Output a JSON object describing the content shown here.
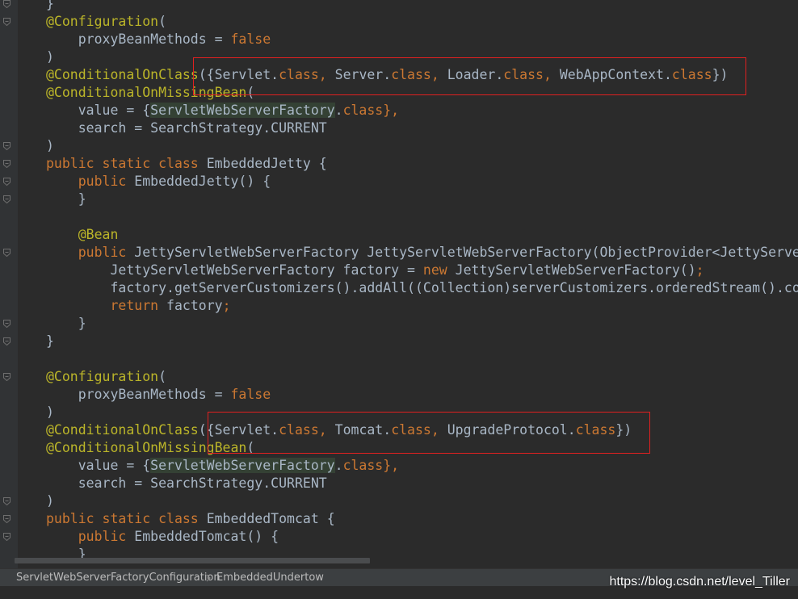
{
  "colors": {
    "background": "#2b2b2b",
    "keyword": "#cc7832",
    "annotation": "#bbb529",
    "text": "#a9b7c6",
    "highlight_box": "#e02020",
    "usage_highlight": "#344134"
  },
  "code_lines": [
    {
      "fold": true,
      "tokens": [
        {
          "t": "}",
          "c": "plain"
        }
      ]
    },
    {
      "fold": true,
      "tokens": [
        {
          "t": "@Configuration",
          "c": "ann"
        },
        {
          "t": "(",
          "c": "plain"
        }
      ]
    },
    {
      "fold": false,
      "tokens": [
        {
          "t": "    proxyBeanMethods = ",
          "c": "plain"
        },
        {
          "t": "false",
          "c": "kw"
        }
      ]
    },
    {
      "fold": false,
      "tokens": [
        {
          "t": ")",
          "c": "plain"
        }
      ]
    },
    {
      "fold": false,
      "tokens": [
        {
          "t": "@ConditionalOnClass",
          "c": "ann"
        },
        {
          "t": "({Servlet.",
          "c": "plain"
        },
        {
          "t": "class",
          "c": "kw"
        },
        {
          "t": ", ",
          "c": "kw"
        },
        {
          "t": "Server.",
          "c": "plain"
        },
        {
          "t": "class",
          "c": "kw"
        },
        {
          "t": ", ",
          "c": "kw"
        },
        {
          "t": "Loader.",
          "c": "plain"
        },
        {
          "t": "class",
          "c": "kw"
        },
        {
          "t": ", ",
          "c": "kw"
        },
        {
          "t": "WebAppContext.",
          "c": "plain"
        },
        {
          "t": "class",
          "c": "kw"
        },
        {
          "t": "})",
          "c": "plain"
        }
      ]
    },
    {
      "fold": false,
      "tokens": [
        {
          "t": "@ConditionalOnMissingBean",
          "c": "ann"
        },
        {
          "t": "(",
          "c": "plain"
        }
      ]
    },
    {
      "fold": false,
      "tokens": [
        {
          "t": "    value = {",
          "c": "plain"
        },
        {
          "t": "ServletWebServerFactory",
          "c": "hl"
        },
        {
          "t": ".",
          "c": "plain"
        },
        {
          "t": "class",
          "c": "kw"
        },
        {
          "t": "},",
          "c": "kw"
        }
      ]
    },
    {
      "fold": false,
      "tokens": [
        {
          "t": "    search = SearchStrategy.CURRENT",
          "c": "plain"
        }
      ]
    },
    {
      "fold": true,
      "tokens": [
        {
          "t": ")",
          "c": "plain"
        }
      ]
    },
    {
      "fold": true,
      "tokens": [
        {
          "t": "public static class ",
          "c": "kw"
        },
        {
          "t": "EmbeddedJetty {",
          "c": "plain"
        }
      ]
    },
    {
      "fold": true,
      "tokens": [
        {
          "t": "    ",
          "c": "plain"
        },
        {
          "t": "public ",
          "c": "kw"
        },
        {
          "t": "EmbeddedJetty() {",
          "c": "plain"
        }
      ]
    },
    {
      "fold": true,
      "tokens": [
        {
          "t": "    }",
          "c": "plain"
        }
      ]
    },
    {
      "fold": false,
      "tokens": [
        {
          "t": "",
          "c": "plain"
        }
      ]
    },
    {
      "fold": false,
      "tokens": [
        {
          "t": "    ",
          "c": "plain"
        },
        {
          "t": "@Bean",
          "c": "ann"
        }
      ]
    },
    {
      "fold": true,
      "tokens": [
        {
          "t": "    ",
          "c": "plain"
        },
        {
          "t": "public ",
          "c": "kw"
        },
        {
          "t": "JettyServletWebServerFactory JettyServletWebServerFactory(ObjectProvider<JettyServerCustomizer>",
          "c": "plain"
        }
      ]
    },
    {
      "fold": false,
      "tokens": [
        {
          "t": "        JettyServletWebServerFactory factory = ",
          "c": "plain"
        },
        {
          "t": "new ",
          "c": "kw"
        },
        {
          "t": "JettyServletWebServerFactory()",
          "c": "plain"
        },
        {
          "t": ";",
          "c": "kw"
        }
      ]
    },
    {
      "fold": false,
      "tokens": [
        {
          "t": "        factory.getServerCustomizers().addAll((Collection)serverCustomizers.orderedStream().collect(",
          "c": "plain"
        }
      ]
    },
    {
      "fold": false,
      "tokens": [
        {
          "t": "        ",
          "c": "plain"
        },
        {
          "t": "return ",
          "c": "kw"
        },
        {
          "t": "factory",
          "c": "plain"
        },
        {
          "t": ";",
          "c": "kw"
        }
      ]
    },
    {
      "fold": true,
      "tokens": [
        {
          "t": "    }",
          "c": "plain"
        }
      ]
    },
    {
      "fold": true,
      "tokens": [
        {
          "t": "}",
          "c": "plain"
        }
      ]
    },
    {
      "fold": false,
      "tokens": [
        {
          "t": "",
          "c": "plain"
        }
      ]
    },
    {
      "fold": true,
      "tokens": [
        {
          "t": "@Configuration",
          "c": "ann"
        },
        {
          "t": "(",
          "c": "plain"
        }
      ]
    },
    {
      "fold": false,
      "tokens": [
        {
          "t": "    proxyBeanMethods = ",
          "c": "plain"
        },
        {
          "t": "false",
          "c": "kw"
        }
      ]
    },
    {
      "fold": false,
      "tokens": [
        {
          "t": ")",
          "c": "plain"
        }
      ]
    },
    {
      "fold": false,
      "tokens": [
        {
          "t": "@ConditionalOnClass",
          "c": "ann"
        },
        {
          "t": "({Servlet.",
          "c": "plain"
        },
        {
          "t": "class",
          "c": "kw"
        },
        {
          "t": ", ",
          "c": "kw"
        },
        {
          "t": "Tomcat.",
          "c": "plain"
        },
        {
          "t": "class",
          "c": "kw"
        },
        {
          "t": ", ",
          "c": "kw"
        },
        {
          "t": "UpgradeProtocol.",
          "c": "plain"
        },
        {
          "t": "class",
          "c": "kw"
        },
        {
          "t": "})",
          "c": "plain"
        }
      ]
    },
    {
      "fold": false,
      "tokens": [
        {
          "t": "@ConditionalOnMissingBean",
          "c": "ann"
        },
        {
          "t": "(",
          "c": "plain"
        }
      ]
    },
    {
      "fold": false,
      "tokens": [
        {
          "t": "    value = {",
          "c": "plain"
        },
        {
          "t": "ServletWebServerFactory",
          "c": "hl"
        },
        {
          "t": ".",
          "c": "plain"
        },
        {
          "t": "class",
          "c": "kw"
        },
        {
          "t": "},",
          "c": "kw"
        }
      ]
    },
    {
      "fold": false,
      "tokens": [
        {
          "t": "    search = SearchStrategy.CURRENT",
          "c": "plain"
        }
      ]
    },
    {
      "fold": true,
      "tokens": [
        {
          "t": ")",
          "c": "plain"
        }
      ]
    },
    {
      "fold": true,
      "tokens": [
        {
          "t": "public static class ",
          "c": "kw"
        },
        {
          "t": "EmbeddedTomcat {",
          "c": "plain"
        }
      ]
    },
    {
      "fold": true,
      "tokens": [
        {
          "t": "    ",
          "c": "plain"
        },
        {
          "t": "public ",
          "c": "kw"
        },
        {
          "t": "EmbeddedTomcat() {",
          "c": "plain"
        }
      ]
    },
    {
      "fold": false,
      "tokens": [
        {
          "t": "    }",
          "c": "plain"
        }
      ]
    }
  ],
  "breadcrumb": {
    "items": [
      "ServletWebServerFactoryConfiguration",
      "EmbeddedUndertow"
    ]
  },
  "watermark": "https://blog.csdn.net/level_Tiller"
}
